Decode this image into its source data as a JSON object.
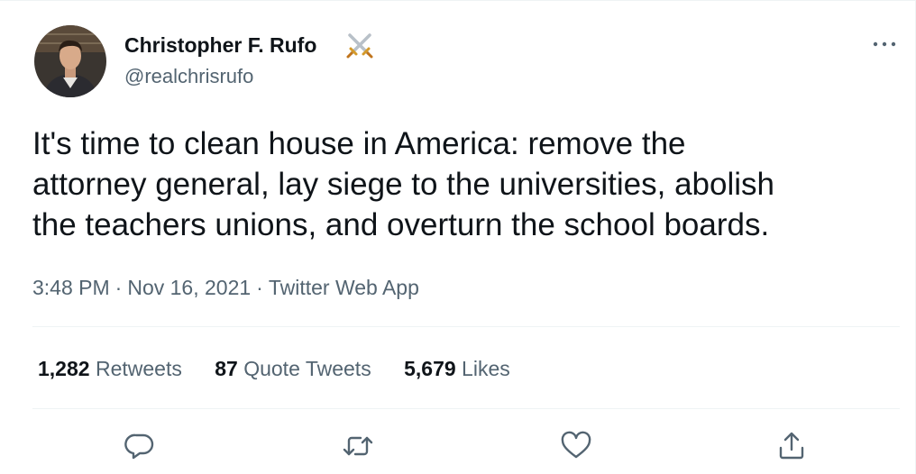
{
  "author": {
    "display_name": "Christopher F. Rufo",
    "name_emoji": "crossed-swords-icon",
    "handle": "@realchrisrufo",
    "avatar": "avatar"
  },
  "tweet": {
    "lines": [
      "It's time to clean house in America: remove the",
      "attorney general, lay siege to the universities, abolish",
      "the teachers unions, and overturn the school boards."
    ],
    "time": "3:48 PM",
    "separator": "·",
    "date": "Nov 16, 2021",
    "source": "Twitter Web App"
  },
  "stats": {
    "retweets": {
      "count": "1,282",
      "label": "Retweets"
    },
    "quotes": {
      "count": "87",
      "label": "Quote Tweets"
    },
    "likes": {
      "count": "5,679",
      "label": "Likes"
    }
  },
  "actions": [
    "reply-icon",
    "retweet-icon",
    "like-icon",
    "share-icon"
  ],
  "colors": {
    "text": "#0f1419",
    "secondary": "#536471",
    "divider": "#eff3f4"
  }
}
